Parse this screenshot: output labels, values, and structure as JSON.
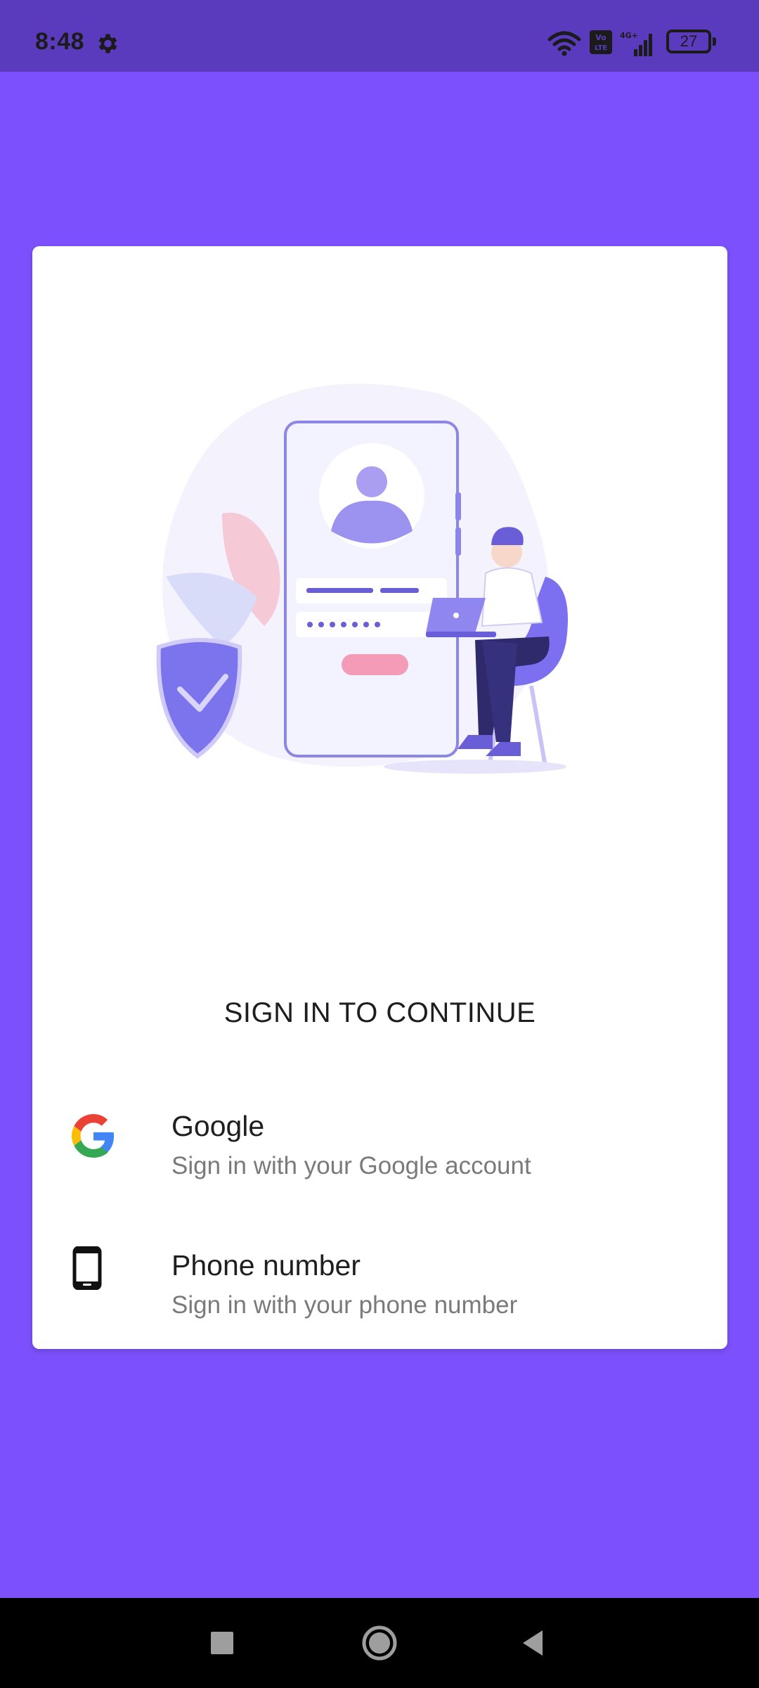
{
  "status_bar": {
    "time": "8:48",
    "battery": "27",
    "network": "4G+",
    "icons": [
      "gear-icon",
      "wifi-icon",
      "volte-icon",
      "signal-icon",
      "battery-icon"
    ]
  },
  "card": {
    "title": "SIGN IN TO CONTINUE",
    "providers": [
      {
        "name": "Google",
        "subtitle": "Sign in with your Google account",
        "icon": "google-icon"
      },
      {
        "name": "Phone number",
        "subtitle": "Sign in with your phone number",
        "icon": "phone-icon"
      }
    ]
  },
  "nav_bar": {
    "buttons": [
      "recents-square-icon",
      "home-circle-icon",
      "back-triangle-icon"
    ]
  },
  "colors": {
    "background": "#7c51fd",
    "status_bar": "#5b3bbd",
    "card": "#ffffff",
    "accent_illustration": "#7c6ff0"
  }
}
